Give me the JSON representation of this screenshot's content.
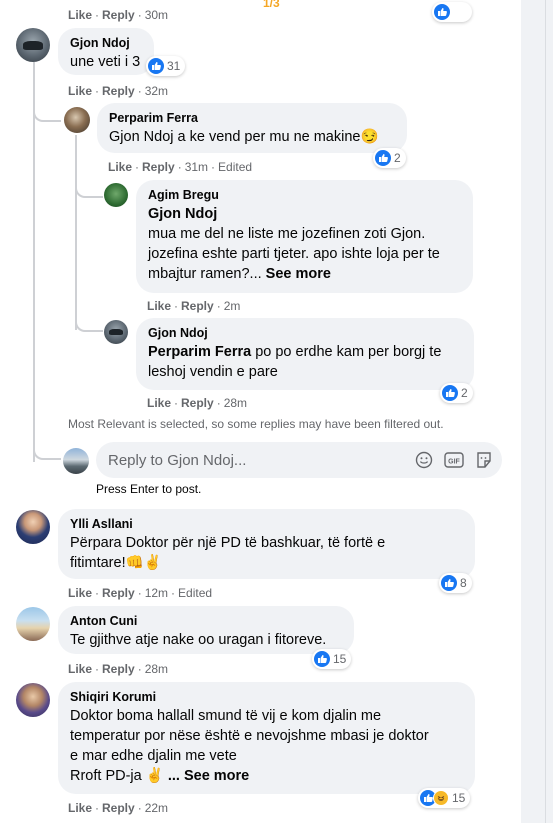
{
  "colors": {
    "bubble_bg": "#f0f2f5",
    "action_grey": "#65676b",
    "like_blue": "#1877f2",
    "text": "#050505"
  },
  "top_fragment": {
    "actions": {
      "like": "Like",
      "reply": "Reply",
      "time": "30m"
    },
    "indicator": "1/3"
  },
  "comments": [
    {
      "id": "gjon-1",
      "avatar": "gjon-avatar",
      "author": "Gjon Ndoj",
      "text": "une veti i 3",
      "reactions": {
        "icons": [
          "like-icon"
        ],
        "count": "31"
      },
      "actions": {
        "like": "Like",
        "reply": "Reply",
        "time": "32m",
        "edited": ""
      }
    },
    {
      "id": "perparim-1",
      "avatar": "perparim-avatar",
      "author": "Perparim Ferra",
      "text": "Gjon Ndoj a ke vend per mu ne makine",
      "emoji": "😏",
      "reactions": {
        "icons": [
          "like-icon"
        ],
        "count": "2"
      },
      "actions": {
        "like": "Like",
        "reply": "Reply",
        "time": "31m",
        "edited": "Edited"
      }
    },
    {
      "id": "agim-1",
      "avatar": "agim-avatar",
      "author": "Agim Bregu",
      "mention": "Gjon Ndoj",
      "text": "mua me del ne liste me jozefinen zoti Gjon.\njozefina eshte parti tjeter. apo ishte loja per te\nmbajtur ramen?...",
      "see_more": "See more",
      "actions": {
        "like": "Like",
        "reply": "Reply",
        "time": "2m"
      }
    },
    {
      "id": "gjon-2",
      "avatar": "gjon-avatar",
      "author": "Gjon Ndoj",
      "mention": "Perparim Ferra",
      "text": "po po erdhe kam per borgj te\nleshoj vendin e pare",
      "reactions": {
        "icons": [
          "like-icon"
        ],
        "count": "2"
      },
      "actions": {
        "like": "Like",
        "reply": "Reply",
        "time": "28m"
      }
    },
    {
      "id": "ylli-1",
      "avatar": "ylli-avatar",
      "author": "Ylli Asllani",
      "text": "Përpara Doktor për një PD të bashkuar, të fortë e\nfitimtare!",
      "emoji": "👊✌",
      "reactions": {
        "icons": [
          "like-icon"
        ],
        "count": "8"
      },
      "actions": {
        "like": "Like",
        "reply": "Reply",
        "time": "12m",
        "edited": "Edited"
      }
    },
    {
      "id": "anton-1",
      "avatar": "anton-avatar",
      "author": "Anton Cuni",
      "text": "Te gjithve atje nake oo uragan i fitoreve.",
      "reactions": {
        "icons": [
          "like-icon"
        ],
        "count": "15"
      },
      "actions": {
        "like": "Like",
        "reply": "Reply",
        "time": "28m"
      }
    },
    {
      "id": "shiqiri-1",
      "avatar": "shiqiri-avatar",
      "author": "Shiqiri Korumi",
      "text": "Doktor boma hallall smund të vij e kom djalin me\ntemperatur por nëse është e nevojshme mbasi je doktor\ne mar edhe djalin me vete\nRroft PD-ja",
      "emoji": "✌",
      "see_more": "... See more",
      "reactions": {
        "icons": [
          "like-icon",
          "haha-icon"
        ],
        "count": "15"
      },
      "actions": {
        "like": "Like",
        "reply": "Reply",
        "time": "22m"
      }
    }
  ],
  "filter_note": "Most Relevant is selected, so some replies may have been filtered out.",
  "reply_box": {
    "placeholder": "Reply to Gjon Ndoj...",
    "hint": "Press Enter to post.",
    "icons": [
      "emoji-icon",
      "gif-icon",
      "sticker-icon"
    ]
  }
}
